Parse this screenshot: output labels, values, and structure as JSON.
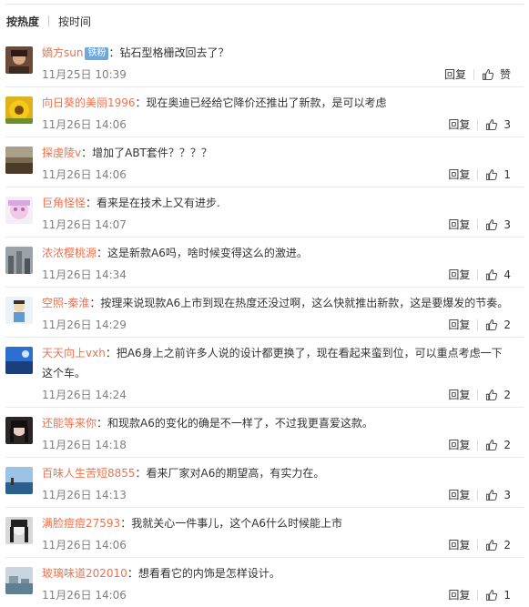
{
  "sort_tabs": [
    "按热度",
    "按时间"
  ],
  "reply_label": "回复",
  "comments": [
    {
      "user": "嫡方sun",
      "badge": "铁粉",
      "text": "：钻石型格栅改回去了？",
      "time": "11月25日 10:39",
      "likes": "赞",
      "avatar": "portrait-dark"
    },
    {
      "user": "向日葵的美丽1996",
      "text": "：现在奥迪已经给它降价还推出了新款，是可以考虑",
      "time": "11月26日 14:06",
      "likes": "3",
      "avatar": "sunflower"
    },
    {
      "user": "探虔陵v",
      "text": "：增加了ABT套件？？？？",
      "time": "11月26日 14:06",
      "likes": "1",
      "avatar": "landscape-brown"
    },
    {
      "user": "巨角怪怪",
      "text": "：看来是在技术上又有进步.",
      "time": "11月26日 14:07",
      "likes": "3",
      "avatar": "anime-pink"
    },
    {
      "user": "浓浓樱桃源",
      "text": "：这是新款A6吗，啥时候变得这么的激进。",
      "time": "11月26日 14:34",
      "likes": "4",
      "avatar": "city-grey"
    },
    {
      "user": "空照-秦淮",
      "text": "：按理来说现款A6上市到现在热度还没过啊，这么快就推出新款，这是要爆发的节奏。",
      "time": "11月26日 14:29",
      "likes": "2",
      "avatar": "cartoon-figure"
    },
    {
      "user": "天天向上vxh",
      "text": "：把A6身上之前许多人说的设计都更换了，现在看起来蛮到位，可以重点考虑一下这个车。",
      "time": "11月26日 14:24",
      "likes": "2",
      "avatar": "sky-blue"
    },
    {
      "user": "还能等来你",
      "text": "：和现款A6的变化的确是不一样了，不过我更喜爱这款。",
      "time": "11月26日 14:18",
      "likes": "2",
      "avatar": "girl-dark"
    },
    {
      "user": "百味人生苦短8855",
      "text": "：看来厂家对A6的期望高，有实力在。",
      "time": "11月26日 14:13",
      "likes": "3",
      "avatar": "seaside"
    },
    {
      "user": "满脸痘痘27593",
      "text": "：我就关心一件事儿，这个A6什么时候能上市",
      "time": "11月26日 14:06",
      "likes": "2",
      "avatar": "girl-bw"
    },
    {
      "user": "玻璃味道202010",
      "text": "：想看看它的内饰是怎样设计。",
      "time": "11月26日 14:06",
      "likes": "1",
      "avatar": "harbor"
    }
  ]
}
